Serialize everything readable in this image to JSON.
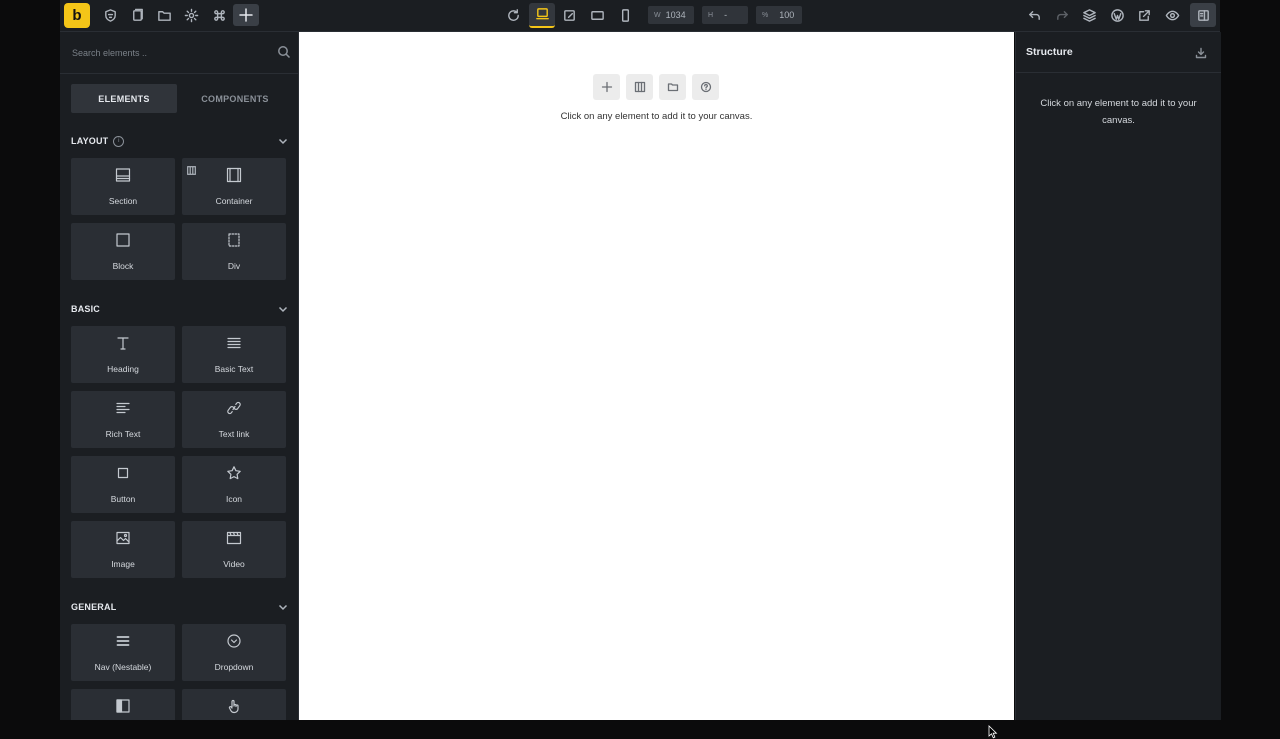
{
  "app": {
    "logo_letter": "b",
    "brand_color": "#f4c518"
  },
  "toolbar": {
    "left_icons": [
      "shield-icon",
      "pages-icon",
      "folder-icon",
      "settings-icon",
      "command-icon",
      "plus-icon"
    ],
    "center_icons": [
      "refresh-icon",
      "desktop-icon",
      "edit-page-icon",
      "tablet-landscape-icon",
      "mobile-icon"
    ],
    "width": {
      "label": "W",
      "value": "1034"
    },
    "height": {
      "label": "H",
      "value": "-"
    },
    "zoom": {
      "label": "%",
      "value": "100"
    },
    "right_icons": [
      "undo-icon",
      "redo-icon",
      "layers-icon",
      "wordpress-icon",
      "external-link-icon",
      "eye-icon",
      "panel-icon"
    ]
  },
  "sidebar": {
    "search_placeholder": "Search elements ..",
    "tabs": [
      "ELEMENTS",
      "COMPONENTS"
    ],
    "active_tab": "ELEMENTS",
    "sections": [
      {
        "title": "LAYOUT",
        "elements": [
          {
            "label": "Section",
            "icon": "section-icon"
          },
          {
            "label": "Container",
            "icon": "container-icon"
          },
          {
            "label": "Block",
            "icon": "block-icon"
          },
          {
            "label": "Div",
            "icon": "div-icon"
          }
        ]
      },
      {
        "title": "BASIC",
        "elements": [
          {
            "label": "Heading",
            "icon": "heading-icon"
          },
          {
            "label": "Basic Text",
            "icon": "basic-text-icon"
          },
          {
            "label": "Rich Text",
            "icon": "rich-text-icon"
          },
          {
            "label": "Text link",
            "icon": "link-icon"
          },
          {
            "label": "Button",
            "icon": "button-icon"
          },
          {
            "label": "Icon",
            "icon": "star-icon"
          },
          {
            "label": "Image",
            "icon": "image-icon"
          },
          {
            "label": "Video",
            "icon": "video-icon"
          }
        ]
      },
      {
        "title": "GENERAL",
        "elements": [
          {
            "label": "Nav (Nestable)",
            "icon": "nav-icon"
          },
          {
            "label": "Dropdown",
            "icon": "dropdown-icon"
          },
          {
            "label": "",
            "icon": "offcanvas-icon"
          },
          {
            "label": "",
            "icon": "pointer-icon"
          }
        ]
      }
    ]
  },
  "canvas": {
    "buttons": [
      "add-icon",
      "columns-icon",
      "folder-icon",
      "help-icon"
    ],
    "hint": "Click on any element to add it to your canvas."
  },
  "structure": {
    "title": "Structure",
    "hint": "Click on any element to add it to your canvas."
  }
}
